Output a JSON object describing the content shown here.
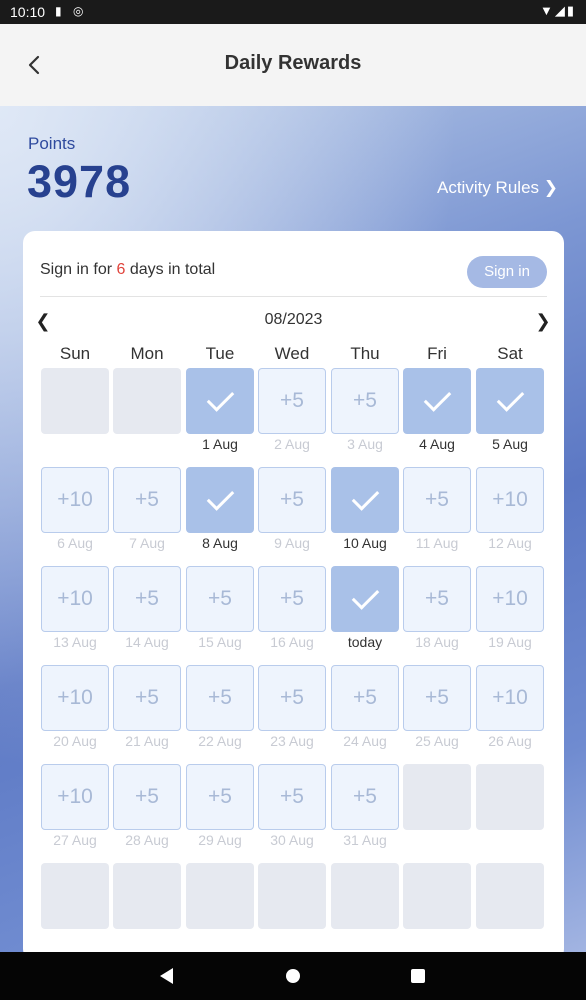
{
  "status_bar": {
    "time": "10:10"
  },
  "header": {
    "title": "Daily Rewards",
    "back_icon": "chevron-left-icon"
  },
  "points": {
    "label": "Points",
    "value": "3978"
  },
  "activity_rules": "Activity Rules ❯",
  "signin": {
    "prefix": "Sign in for ",
    "count": "6",
    "suffix": " days in total",
    "button": "Sign in"
  },
  "calendar": {
    "month": "08/2023",
    "prev": "❮",
    "next": "❯",
    "weekdays": [
      "Sun",
      "Mon",
      "Tue",
      "Wed",
      "Thu",
      "Fri",
      "Sat"
    ],
    "days": [
      {
        "state": "empty"
      },
      {
        "state": "empty"
      },
      {
        "state": "checked",
        "date": "1 Aug"
      },
      {
        "state": "reward",
        "reward": "+5",
        "date": "2 Aug"
      },
      {
        "state": "reward",
        "reward": "+5",
        "date": "3 Aug"
      },
      {
        "state": "checked",
        "date": "4 Aug"
      },
      {
        "state": "checked",
        "date": "5 Aug"
      },
      {
        "state": "reward",
        "reward": "+10",
        "date": "6 Aug"
      },
      {
        "state": "reward",
        "reward": "+5",
        "date": "7 Aug"
      },
      {
        "state": "checked",
        "date": "8 Aug"
      },
      {
        "state": "reward",
        "reward": "+5",
        "date": "9 Aug"
      },
      {
        "state": "checked",
        "date": "10 Aug"
      },
      {
        "state": "reward",
        "reward": "+5",
        "date": "11 Aug"
      },
      {
        "state": "reward",
        "reward": "+10",
        "date": "12 Aug"
      },
      {
        "state": "reward",
        "reward": "+10",
        "date": "13 Aug"
      },
      {
        "state": "reward",
        "reward": "+5",
        "date": "14 Aug"
      },
      {
        "state": "reward",
        "reward": "+5",
        "date": "15 Aug"
      },
      {
        "state": "reward",
        "reward": "+5",
        "date": "16 Aug"
      },
      {
        "state": "checked",
        "date": "today"
      },
      {
        "state": "reward",
        "reward": "+5",
        "date": "18 Aug"
      },
      {
        "state": "reward",
        "reward": "+10",
        "date": "19 Aug"
      },
      {
        "state": "reward",
        "reward": "+10",
        "date": "20 Aug"
      },
      {
        "state": "reward",
        "reward": "+5",
        "date": "21 Aug"
      },
      {
        "state": "reward",
        "reward": "+5",
        "date": "22 Aug"
      },
      {
        "state": "reward",
        "reward": "+5",
        "date": "23 Aug"
      },
      {
        "state": "reward",
        "reward": "+5",
        "date": "24 Aug"
      },
      {
        "state": "reward",
        "reward": "+5",
        "date": "25 Aug"
      },
      {
        "state": "reward",
        "reward": "+10",
        "date": "26 Aug"
      },
      {
        "state": "reward",
        "reward": "+10",
        "date": "27 Aug"
      },
      {
        "state": "reward",
        "reward": "+5",
        "date": "28 Aug"
      },
      {
        "state": "reward",
        "reward": "+5",
        "date": "29 Aug"
      },
      {
        "state": "reward",
        "reward": "+5",
        "date": "30 Aug"
      },
      {
        "state": "reward",
        "reward": "+5",
        "date": "31 Aug"
      },
      {
        "state": "empty"
      },
      {
        "state": "empty"
      },
      {
        "state": "empty"
      },
      {
        "state": "empty"
      },
      {
        "state": "empty"
      },
      {
        "state": "empty"
      },
      {
        "state": "empty"
      },
      {
        "state": "empty"
      },
      {
        "state": "empty"
      }
    ]
  },
  "colors": {
    "accent": "#27418f",
    "highlight_red": "#e0433b",
    "checked_cell": "#a9c1e8",
    "reward_cell": "#eef4fd"
  },
  "nav_bar": {
    "icons": [
      "back-triangle-icon",
      "home-circle-icon",
      "recents-square-icon"
    ]
  }
}
